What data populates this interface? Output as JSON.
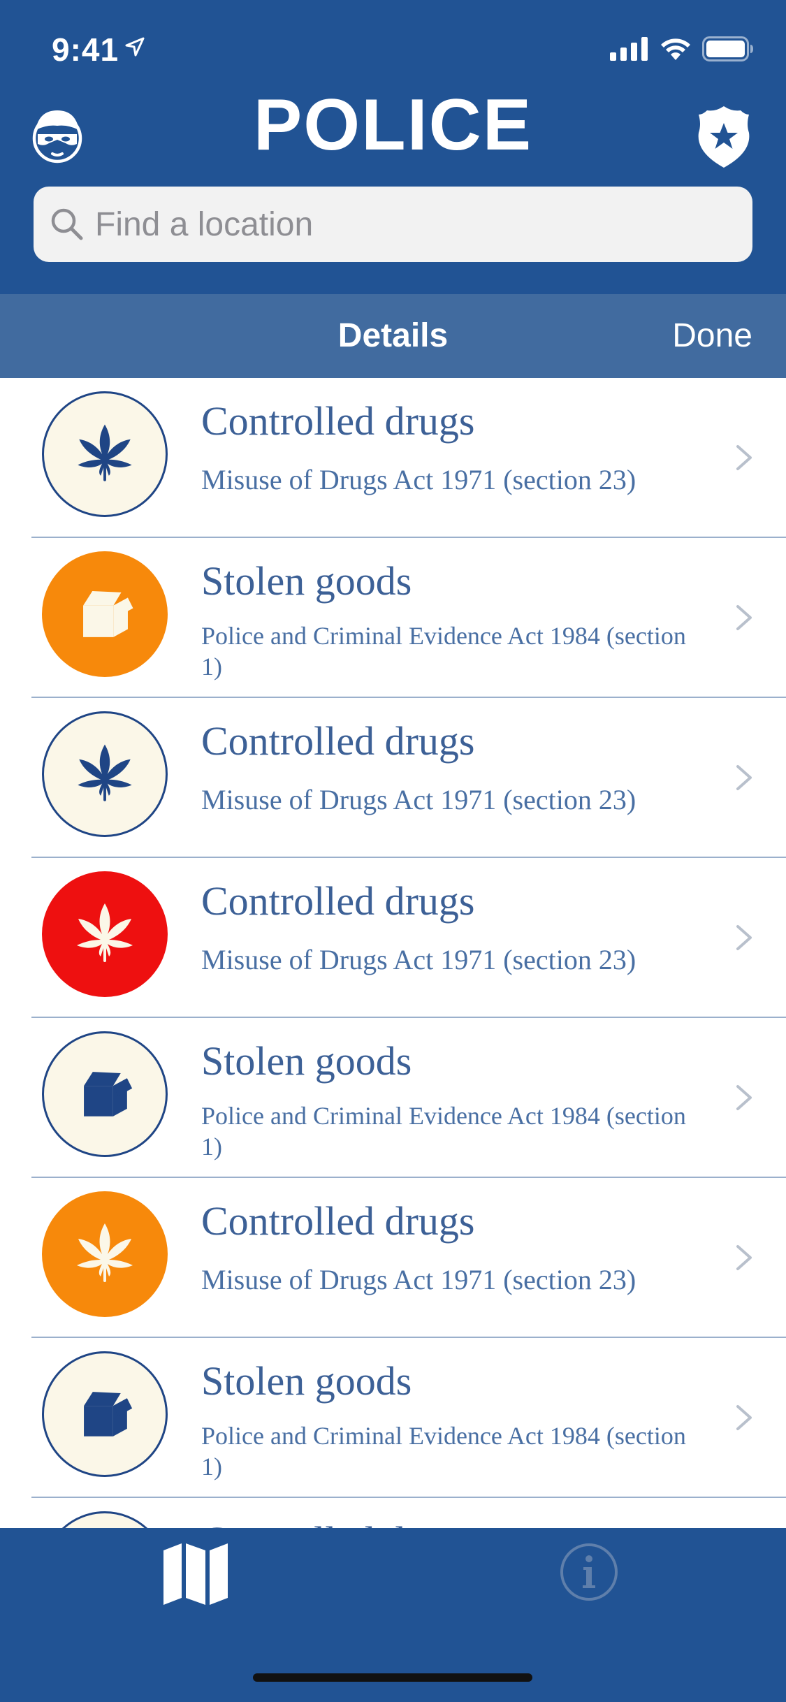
{
  "status_bar": {
    "time": "9:41"
  },
  "header": {
    "title": "POLICE",
    "left_icon": "robber-mask-icon",
    "right_icon": "police-badge-icon"
  },
  "search": {
    "placeholder": "Find a location",
    "value": ""
  },
  "subheader": {
    "title": "Details",
    "done_label": "Done"
  },
  "colors": {
    "brand_blue": "#215394",
    "subheader_blue": "#416b9f",
    "text_blue": "#3c6096",
    "orange": "#f7890b",
    "red": "#ee1010",
    "cream": "#fbf7e8",
    "navy_icon": "#1f4585"
  },
  "list": {
    "items": [
      {
        "title": "Controlled drugs",
        "subtitle": "Misuse of Drugs Act 1971 (section 23)",
        "icon": "cannabis-leaf-icon",
        "style": "cream"
      },
      {
        "title": "Stolen goods",
        "subtitle": "Police and Criminal Evidence Act 1984 (section 1)",
        "icon": "open-box-icon",
        "style": "orange"
      },
      {
        "title": "Controlled drugs",
        "subtitle": "Misuse of Drugs Act 1971 (section 23)",
        "icon": "cannabis-leaf-icon",
        "style": "cream"
      },
      {
        "title": "Controlled drugs",
        "subtitle": "Misuse of Drugs Act 1971 (section 23)",
        "icon": "cannabis-leaf-icon",
        "style": "red"
      },
      {
        "title": "Stolen goods",
        "subtitle": "Police and Criminal Evidence Act 1984 (section 1)",
        "icon": "open-box-icon",
        "style": "cream"
      },
      {
        "title": "Controlled drugs",
        "subtitle": "Misuse of Drugs Act 1971 (section 23)",
        "icon": "cannabis-leaf-icon",
        "style": "orange"
      },
      {
        "title": "Stolen goods",
        "subtitle": "Police and Criminal Evidence Act 1984 (section 1)",
        "icon": "open-box-icon",
        "style": "cream"
      },
      {
        "title": "Controlled drugs",
        "subtitle": "",
        "icon": "cannabis-leaf-icon",
        "style": "cream"
      }
    ]
  },
  "tabbar": {
    "tabs": [
      {
        "name": "map",
        "icon": "map-icon",
        "selected": true
      },
      {
        "name": "info",
        "icon": "info-icon",
        "selected": false
      }
    ]
  }
}
